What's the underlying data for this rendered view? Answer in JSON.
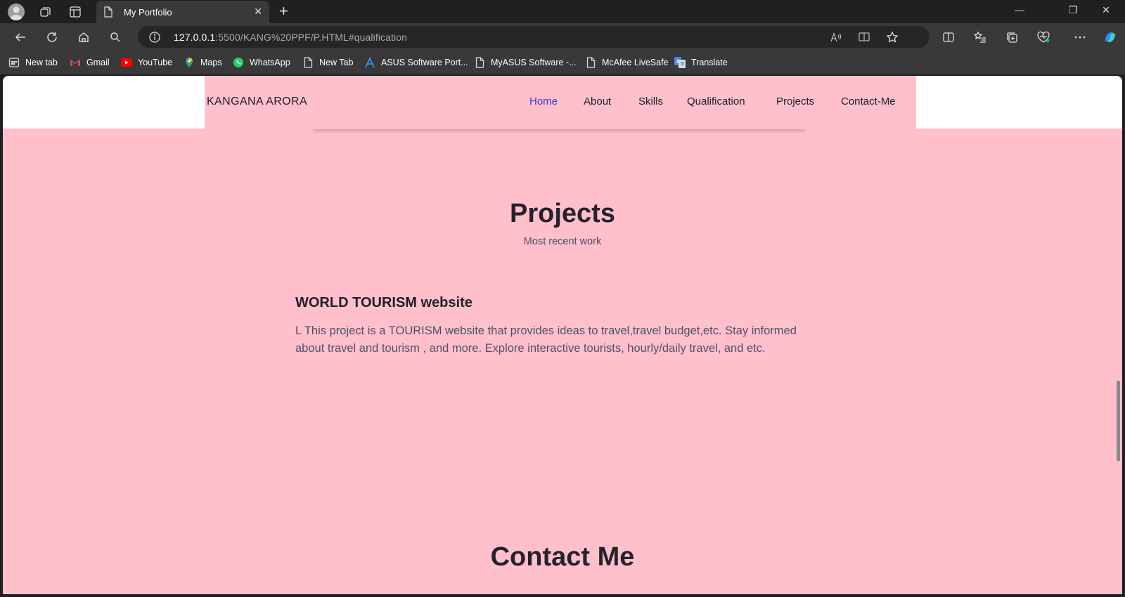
{
  "browser": {
    "tab_title": "My Portfolio",
    "url_host": "127.0.0.1",
    "url_rest": ":5500/KANG%20PPF/P.HTML#qualification",
    "new_tab_symbol": "+",
    "close_symbol": "✕",
    "minimize_symbol": "—",
    "restore_symbol": "❐",
    "window_close_symbol": "✕"
  },
  "bookmarks": [
    {
      "label": "New tab",
      "icon": "grid-icon"
    },
    {
      "label": "Gmail",
      "icon": "gmail-icon"
    },
    {
      "label": "YouTube",
      "icon": "youtube-icon"
    },
    {
      "label": "Maps",
      "icon": "maps-icon"
    },
    {
      "label": "WhatsApp",
      "icon": "whatsapp-icon"
    },
    {
      "label": "New Tab",
      "icon": "page-icon"
    },
    {
      "label": "ASUS Software Port...",
      "icon": "asus-icon"
    },
    {
      "label": "MyASUS Software -...",
      "icon": "page-icon"
    },
    {
      "label": "McAfee LiveSafe",
      "icon": "page-icon"
    },
    {
      "label": "Translate",
      "icon": "translate-icon"
    }
  ],
  "page": {
    "brand": "KANGANA ARORA",
    "nav": [
      {
        "label": "Home",
        "active": true
      },
      {
        "label": "About",
        "active": false
      },
      {
        "label": "Skills",
        "active": false
      },
      {
        "label": "Qualification",
        "active": false
      },
      {
        "label": "Projects",
        "active": false
      },
      {
        "label": "Contact-Me",
        "active": false
      }
    ],
    "projects": {
      "title": "Projects",
      "subtitle": "Most recent work",
      "item": {
        "title": "WORLD TOURISM website",
        "description": "L This project is a TOURISM website that provides ideas to travel,travel budget,etc. Stay informed about travel and tourism , and more. Explore interactive tourists, hourly/daily travel, and etc."
      }
    },
    "contact": {
      "title": "Contact Me"
    }
  },
  "colors": {
    "page_bg": "#ffc0cb",
    "nav_active": "#3a3ad6",
    "text_dark": "#1f1f28"
  }
}
